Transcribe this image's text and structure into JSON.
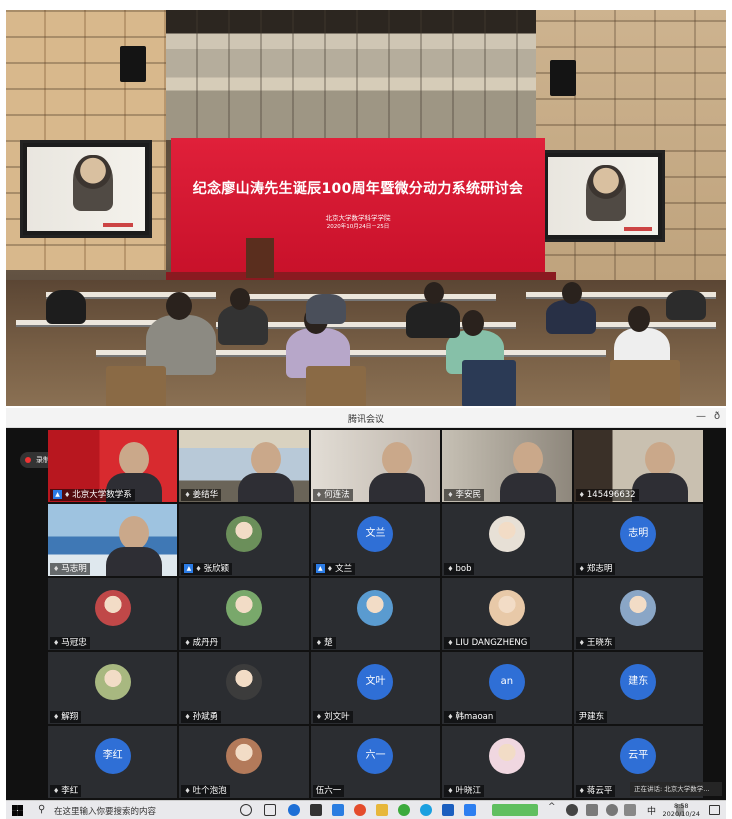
{
  "hall": {
    "banner_title": "纪念廖山涛先生诞辰100周年暨微分动力系统研讨会",
    "banner_org": "北京大学数学科学学院",
    "banner_date": "2020年10月24日－25日"
  },
  "meeting": {
    "app_title": "腾讯会议",
    "window_minimize": "—",
    "window_pin": "ð",
    "recording_label": "录制中",
    "speaking_label": "正在讲话: 北京大学数学...",
    "participants": [
      {
        "name": "北京大学数学系",
        "kind": "video",
        "host": true,
        "mic": true
      },
      {
        "name": "姜结华",
        "kind": "video",
        "host": false,
        "mic": true
      },
      {
        "name": "何连法",
        "kind": "video",
        "host": false,
        "mic": true
      },
      {
        "name": "李安民",
        "kind": "video",
        "host": false,
        "mic": true
      },
      {
        "name": "145496632",
        "kind": "video",
        "host": false,
        "mic": true
      },
      {
        "name": "马志明",
        "kind": "video",
        "host": false,
        "mic": true
      },
      {
        "name": "张欣颖",
        "kind": "photo",
        "host": true,
        "mic": true
      },
      {
        "name": "文兰",
        "kind": "circle",
        "initials": "文兰",
        "host": true,
        "mic": true
      },
      {
        "name": "bob",
        "kind": "photo",
        "host": false,
        "mic": true
      },
      {
        "name": "郑志明",
        "kind": "circle",
        "initials": "志明",
        "host": false,
        "mic": true
      },
      {
        "name": "马冠忠",
        "kind": "photo",
        "host": false,
        "mic": true
      },
      {
        "name": "成丹丹",
        "kind": "photo",
        "host": false,
        "mic": true
      },
      {
        "name": "楚",
        "kind": "photo",
        "host": false,
        "mic": true
      },
      {
        "name": "LIU DANGZHENG",
        "kind": "photo",
        "host": false,
        "mic": true
      },
      {
        "name": "王晓东",
        "kind": "photo",
        "host": false,
        "mic": true
      },
      {
        "name": "解翔",
        "kind": "photo",
        "host": false,
        "mic": true
      },
      {
        "name": "孙斌勇",
        "kind": "photo",
        "host": false,
        "mic": true
      },
      {
        "name": "刘文叶",
        "kind": "circle",
        "initials": "文叶",
        "host": false,
        "mic": true
      },
      {
        "name": "韩maoan",
        "kind": "circle",
        "initials": "an",
        "host": false,
        "mic": true
      },
      {
        "name": "尹建东",
        "kind": "circle",
        "initials": "建东",
        "host": false,
        "mic": false
      },
      {
        "name": "李红",
        "kind": "circle",
        "initials": "李红",
        "host": false,
        "mic": true
      },
      {
        "name": "吐个泡泡",
        "kind": "photo",
        "host": false,
        "mic": true
      },
      {
        "name": "伍六一",
        "kind": "circle",
        "initials": "六一",
        "host": false,
        "mic": false
      },
      {
        "name": "叶晓江",
        "kind": "photo",
        "host": false,
        "mic": true
      },
      {
        "name": "蒋云平",
        "kind": "circle",
        "initials": "云平",
        "host": false,
        "mic": true
      }
    ]
  },
  "taskbar": {
    "search_placeholder": "在这里输入你要搜索的内容",
    "ime": "中",
    "time": "8:58",
    "date": "2020/10/24"
  }
}
